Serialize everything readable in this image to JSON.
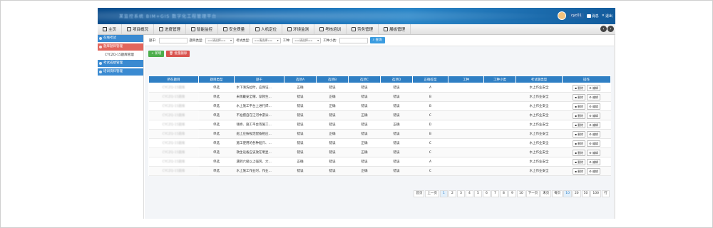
{
  "header": {
    "title": "某监控系统 BIM+GIS 数字化工程管理平台",
    "user": "cyc01",
    "messages_label": "消息",
    "logout_label": "退出"
  },
  "nav": {
    "items": [
      "主页",
      "项目概况",
      "进度管理",
      "智能监控",
      "安全质量",
      "人机定位",
      "环境监测",
      "考核培训",
      "劳务管理",
      "展板管理"
    ]
  },
  "sidebar": {
    "items": [
      {
        "label": "在线考试",
        "style": "blue"
      },
      {
        "label": "题库题目管理",
        "style": "red"
      },
      {
        "label": "CYCZQ-15题库管理",
        "style": "sub"
      },
      {
        "label": "考试成绩管理",
        "style": "blue"
      },
      {
        "label": "培训资料管理",
        "style": "blue"
      }
    ]
  },
  "filters": {
    "stem_label": "题干:",
    "type_label": "题目类型:",
    "type_value": "==请选择==",
    "exam_type_label": "考试类型:",
    "exam_type_value": "==请选择==",
    "job_label": "工种:",
    "job_value": "==请选择==",
    "job_sub_label": "工种小类:",
    "query_label": "查询"
  },
  "actions": {
    "add_label": "新增",
    "batch_delete_label": "批量删除"
  },
  "table": {
    "headers": [
      "所在题目",
      "题目类型",
      "题干",
      "选项A",
      "选项B",
      "选项C",
      "选项D",
      "正确答案",
      "工种",
      "工种小类",
      "考试题类型",
      "操作"
    ],
    "rows": [
      {
        "bank": "CYCZQ-15题库",
        "type": "单选",
        "stem": "水下清洗拉时，应保证...",
        "a": "正确",
        "b": "错误",
        "c": "错误",
        "d": "错误",
        "ans": "A",
        "job": "",
        "jobsub": "",
        "etype": "水上作业安全"
      },
      {
        "bank": "CYCZQ-15题库",
        "type": "单选",
        "stem": "未佩戴安全帽、穿救生...",
        "a": "错误",
        "b": "正确",
        "c": "错误",
        "d": "错误",
        "ans": "B",
        "job": "",
        "jobsub": "",
        "etype": "水上作业安全"
      },
      {
        "bank": "CYCZQ-15题库",
        "type": "单选",
        "stem": "水上施工平台上进行焊...",
        "a": "错误",
        "b": "正确",
        "c": "错误",
        "d": "错误",
        "ans": "B",
        "job": "",
        "jobsub": "",
        "etype": "水上作业安全"
      },
      {
        "bank": "CYCZQ-15题库",
        "type": "单选",
        "stem": "不准擅自在江河中游泳...",
        "a": "错误",
        "b": "错误",
        "c": "正确",
        "d": "错误",
        "ans": "C",
        "job": "",
        "jobsub": "",
        "etype": "水上作业安全"
      },
      {
        "bank": "CYCZQ-15题库",
        "type": "单选",
        "stem": "钱桥、施工平台等施工...",
        "a": "错误",
        "b": "错误",
        "c": "错误",
        "d": "正确",
        "ans": "D",
        "job": "",
        "jobsub": "",
        "etype": "水上作业安全"
      },
      {
        "bank": "CYCZQ-15题库",
        "type": "单选",
        "stem": "船上应按规定配备相应...",
        "a": "错误",
        "b": "正确",
        "c": "错误",
        "d": "错误",
        "ans": "B",
        "job": "",
        "jobsub": "",
        "etype": "水上作业安全"
      },
      {
        "bank": "CYCZQ-15题库",
        "type": "单选",
        "stem": "施工使用的各种船只、...",
        "a": "错误",
        "b": "错误",
        "c": "正确",
        "d": "错误",
        "ans": "C",
        "job": "",
        "jobsub": "",
        "etype": "水上作业安全"
      },
      {
        "bank": "CYCZQ-15题库",
        "type": "单选",
        "stem": "救生设备应该放在明显...",
        "a": "错误",
        "b": "错误",
        "c": "正确",
        "d": "错误",
        "ans": "C",
        "job": "",
        "jobsub": "",
        "etype": "水上作业安全"
      },
      {
        "bank": "CYCZQ-15题库",
        "type": "单选",
        "stem": "遇到六级以上强风、大...",
        "a": "正确",
        "b": "错误",
        "c": "错误",
        "d": "错误",
        "ans": "A",
        "job": "",
        "jobsub": "",
        "etype": "水上作业安全"
      },
      {
        "bank": "CYCZQ-15题库",
        "type": "单选",
        "stem": "水上施工作业时，作业...",
        "a": "错误",
        "b": "错误",
        "c": "正确",
        "d": "错误",
        "ans": "C",
        "job": "",
        "jobsub": "",
        "etype": "水上作业安全"
      }
    ],
    "delete_label": "删除",
    "edit_label": "编辑"
  },
  "pager": {
    "first": "首页",
    "prev": "上一页",
    "pages": [
      "1",
      "2",
      "3",
      "4",
      "5",
      "6",
      "7",
      "8",
      "9",
      "10"
    ],
    "next": "下一页",
    "last": "末页",
    "per_page_label": "每页",
    "sizes": [
      "10",
      "20",
      "50",
      "100"
    ],
    "more": "行",
    "current_page": "1",
    "current_size": "10"
  }
}
